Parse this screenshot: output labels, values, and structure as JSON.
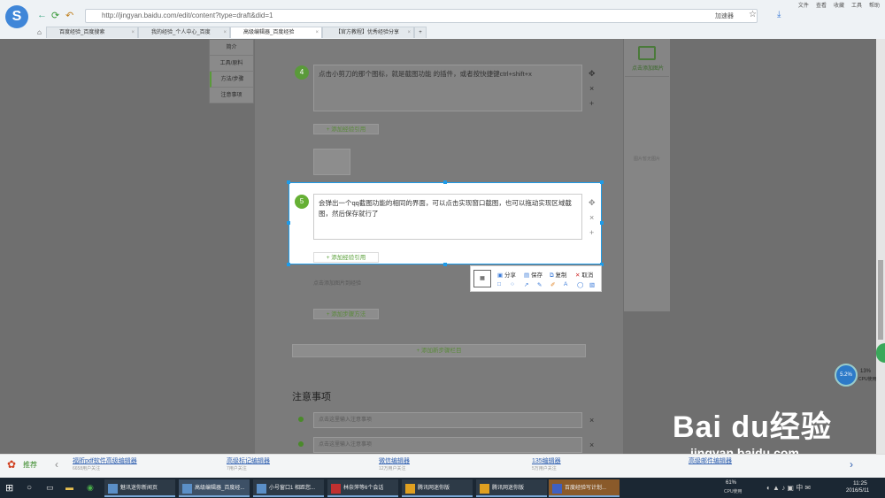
{
  "browser": {
    "url": "http://jingyan.baidu.com/edit/content?type=draft&did=1",
    "menu": [
      "文件",
      "查看",
      "收藏",
      "工具",
      "帮助"
    ],
    "account": "加速器",
    "tabs": [
      {
        "label": "百度经验_百度搜索",
        "active": false
      },
      {
        "label": "我的经验_个人中心_百度",
        "active": false
      },
      {
        "label": "高级编辑器_百度经验",
        "active": true
      },
      {
        "label": "【官方教程】优秀经验分享",
        "active": false
      }
    ]
  },
  "left_nav": [
    "简介",
    "工具/原料",
    "方法/步骤",
    "注意事项"
  ],
  "steps": [
    {
      "num": "4",
      "text": "点击小剪刀的那个图标，就是截图功能 的插件，或者按快捷键ctrl+shift+x",
      "add_ref": "+ 添加经验引用"
    },
    {
      "num": "5",
      "text": "会弹出一个qq截图功能的相同的界面，可以点击实现窗口截图，也可以拖动实现区域截图，然后保存就行了",
      "add_ref": "+ 添加经验引用"
    }
  ],
  "step_controls": {
    "move": "✥",
    "delete": "×",
    "add": "+"
  },
  "add_step_method": "+ 添加步骤方法",
  "add_step_section": "+ 添加新步骤栏目",
  "notes": {
    "title": "注意事项",
    "placeholder": "点击这里输入注意事项"
  },
  "right_panel": {
    "add_image": "点击添加图片",
    "no_image": "图片暂无图片"
  },
  "hint_text": "点击添加图片到经验",
  "screenshot_toolbar": {
    "share": "分享",
    "save": "保存",
    "copy": "复制",
    "cancel": "取消"
  },
  "recommend": {
    "label": "推荐",
    "items": [
      {
        "title": "福昕pdf软件高级编辑器",
        "sub": "6658用户关注"
      },
      {
        "title": "高级标记编辑器",
        "sub": "7用户关注"
      },
      {
        "title": "微信编辑器",
        "sub": "12万用户关注"
      },
      {
        "title": "135编辑器",
        "sub": "5万用户关注"
      },
      {
        "title": "高级邮件编辑器",
        "sub": ""
      }
    ]
  },
  "taskbar": {
    "items": [
      "魅讯迷你新闻页",
      "高级编辑器_百度经...",
      "小号窗口1 相距您...",
      "林奈萍等6个会话",
      "腾讯网迷你版",
      "腾讯网迷你版",
      "百度经验写计划..."
    ],
    "cpu": "61%",
    "cpu_label": "CPU使用",
    "time": "11:25",
    "date": "2016/5/11"
  },
  "gauge": {
    "value": "5.2%",
    "pct": "13%",
    "label": "CPU使用"
  },
  "watermark": {
    "brand": "Bai du经验",
    "url": "jingyan.baidu.com"
  }
}
